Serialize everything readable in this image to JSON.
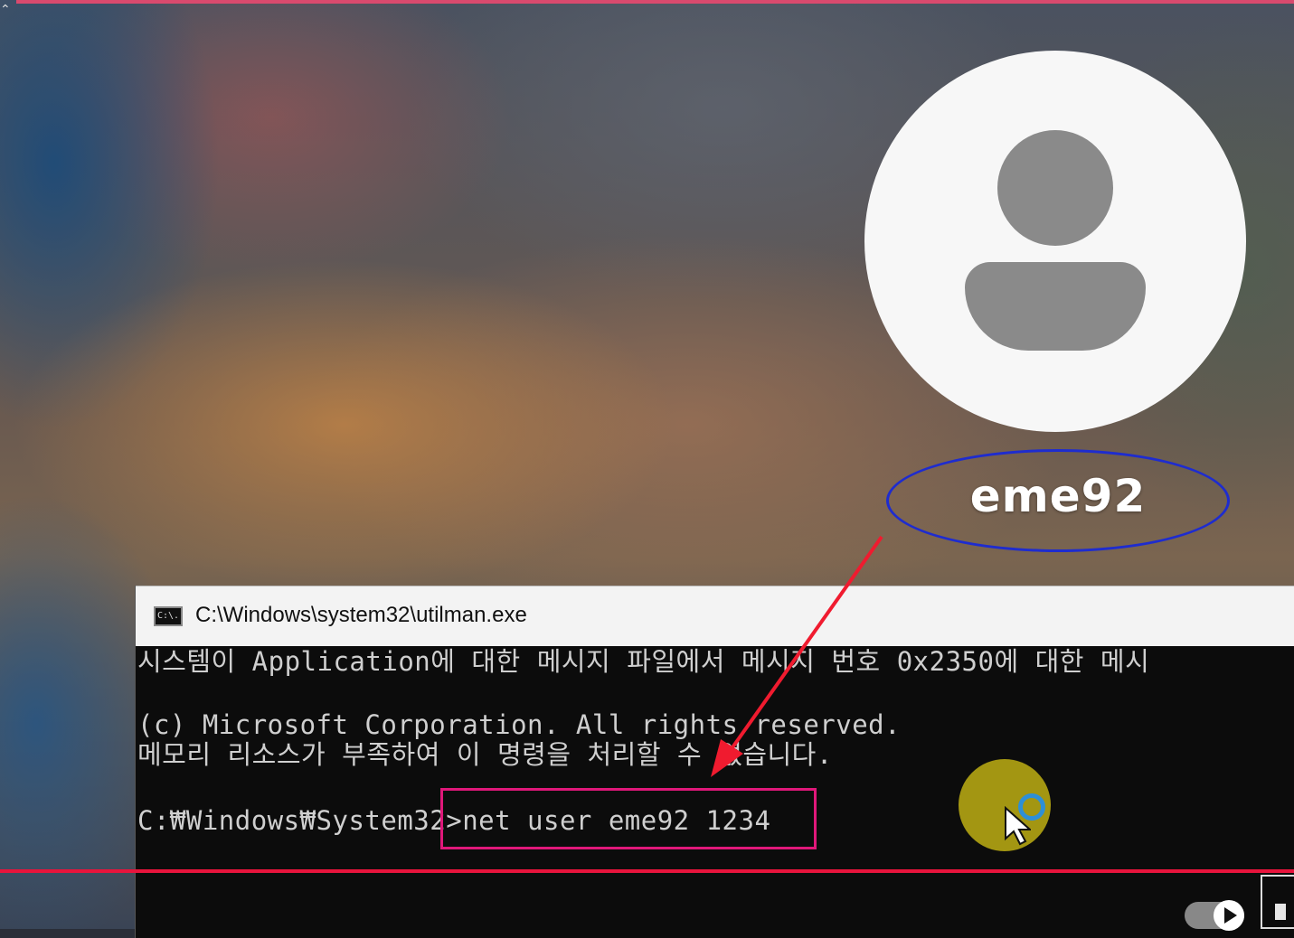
{
  "login_screen": {
    "username": "eme92"
  },
  "cmd": {
    "title": "C:\\Windows\\system32\\utilman.exe",
    "icon_text": "C:\\.",
    "lines": [
      "시스템이 Application에 대한 메시지 파일에서 메시지 번호 0x2350에 대한 메시",
      "(c) Microsoft Corporation. All rights reserved.",
      "메모리 리소스가 부족하여 이 명령을 처리할 수 없습니다.",
      "C:₩Windows₩System32>net user eme92 1234"
    ]
  },
  "annotations": {
    "ellipse_color": "#1e2ccf",
    "highlight_color": "#e0187a",
    "arrow_color": "#f01b2f",
    "divider_color": "#e8143c"
  },
  "icons": {
    "avatar": "user-avatar-icon",
    "cmd": "console-icon",
    "cursor": "mouse-pointer-icon",
    "toggle": "toggle-icon"
  }
}
